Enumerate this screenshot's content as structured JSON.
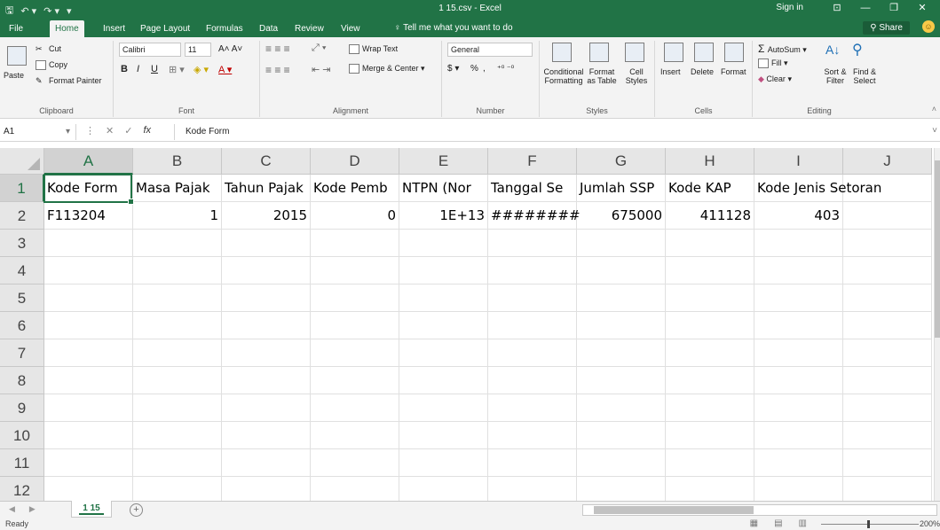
{
  "titlebar": {
    "doc_title": "1 15.csv - Excel",
    "sign_in": "Sign in",
    "qat_save": "🖫",
    "qat_undo": "↶ ▾",
    "qat_redo": "↷ ▾",
    "qat_custom": "▾"
  },
  "tabs": {
    "items": [
      "File",
      "Home",
      "Insert",
      "Page Layout",
      "Formulas",
      "Data",
      "Review",
      "View"
    ],
    "active": "Home",
    "tell_me": "Tell me what you want to do",
    "share": "Share"
  },
  "ribbon": {
    "clipboard": {
      "paste": "Paste",
      "cut": "Cut",
      "copy": "Copy",
      "format_painter": "Format Painter",
      "label": "Clipboard"
    },
    "font": {
      "name": "Calibri",
      "size": "11",
      "label": "Font",
      "bold": "B",
      "italic": "I",
      "underline": "U"
    },
    "alignment": {
      "wrap_text": "Wrap Text",
      "merge_center": "Merge & Center",
      "label": "Alignment"
    },
    "number": {
      "format": "General",
      "percent": "%",
      "comma": ",",
      "label": "Number"
    },
    "styles": {
      "conditional": "Conditional Formatting",
      "format_table": "Format as Table",
      "cell_styles": "Cell Styles",
      "label": "Styles"
    },
    "cells": {
      "insert": "Insert",
      "delete": "Delete",
      "format": "Format",
      "label": "Cells"
    },
    "editing": {
      "autosum": "AutoSum",
      "fill": "Fill",
      "clear": "Clear",
      "sort_filter": "Sort & Filter",
      "find_select": "Find & Select",
      "label": "Editing"
    }
  },
  "formula_bar": {
    "name_box": "A1",
    "fx": "fx",
    "content": "Kode Form"
  },
  "grid": {
    "columns": [
      "A",
      "B",
      "C",
      "D",
      "E",
      "F",
      "G",
      "H",
      "I",
      "J"
    ],
    "rows": [
      "1",
      "2",
      "3",
      "4",
      "5",
      "6",
      "7",
      "8",
      "9",
      "10",
      "11",
      "12"
    ],
    "row1": [
      "Kode Form",
      "Masa Pajak",
      "Tahun Pajak",
      "Kode Pemb",
      "NTPN (Nor",
      "Tanggal Se",
      "Jumlah SSP",
      "Kode KAP",
      "Kode Jenis Setoran",
      ""
    ],
    "row2": [
      "F113204",
      "1",
      "2015",
      "0",
      "1E+13",
      "########",
      "675000",
      "411128",
      "403",
      ""
    ]
  },
  "sheets": {
    "active": "1 15",
    "add": "+"
  },
  "status": {
    "ready": "Ready",
    "zoom": "200%"
  }
}
